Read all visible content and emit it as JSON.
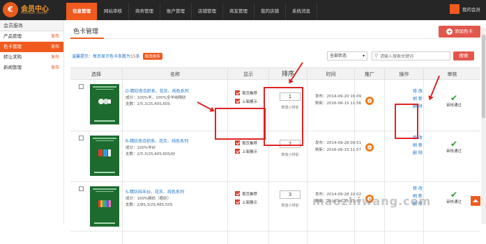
{
  "app": {
    "logo_glyph": "€",
    "title": "会员中心",
    "subtitle": "Member center"
  },
  "topnav": [
    {
      "label": "信息管理",
      "active": true
    },
    {
      "label": "网站审核"
    },
    {
      "label": "商务管理"
    },
    {
      "label": "账户管理"
    },
    {
      "label": "店铺管理"
    },
    {
      "label": "商友管理"
    },
    {
      "label": "我的店铺"
    },
    {
      "label": "系统消息"
    }
  ],
  "user": {
    "name": "我的会员"
  },
  "sidebar": {
    "heading": "会员服务",
    "items": [
      {
        "label": "产品管理",
        "tag": "发布"
      },
      {
        "label": "色卡管理",
        "tag": "发布",
        "active": true
      },
      {
        "label": "转让求购",
        "tag": "发布"
      },
      {
        "label": "新闻管理",
        "tag": "发布"
      }
    ]
  },
  "page": {
    "title": "色卡管理",
    "add_label": "添加色卡",
    "tip_label": "温馨提示：",
    "tip_text": "每页显示色卡条数为",
    "tip_red": "15",
    "tip_link": "条",
    "tip_button": "修改排序",
    "status_select": "全部状态",
    "search_placeholder": "请输入搜索关键词",
    "search_label": "搜索"
  },
  "columns": [
    "选择",
    "名称",
    "显示",
    "排序",
    "时间",
    "推广",
    "操作",
    "审核"
  ],
  "rows": [
    {
      "title": "D-精纺南合织系、花灰、纯色系列",
      "spec1": "成分：100%羊，100%全羊纯精纺",
      "spec2": "支数：2/5,3/2S,40S,60S",
      "show_home": "首页推荐",
      "show_list": "上架展示",
      "sort": "1",
      "sort_hint": "数值小排前",
      "published": "发布：2014-09-20 16:09",
      "updated": "刷新：2016-06-15 11:56",
      "op_edit": "修 改",
      "op_refresh": "刷 新",
      "op_delete": "删 除",
      "audit": "审核通过"
    },
    {
      "title": "R-精纺南合织系、花灰、纯色系列",
      "spec1": "成分：100%羊纱",
      "spec2": "支数：2/5,3/2S,40S,60S/纱",
      "show_home": "首页推荐",
      "show_list": "上架展示",
      "sort": "2",
      "sort_hint": "数值小排前",
      "published": "发布：2014-09-28 09:51",
      "updated": "刷新：2016-06-15 11:57",
      "op_edit": "修 改",
      "op_refresh": "刷 新",
      "op_delete": "删 除",
      "audit": "审核通过"
    },
    {
      "title": "S-精纺纯羊纱、花灰、纯色系列",
      "spec1": "成分：100%精纺（粗纺）",
      "spec2": "支数：2/8S,3/2S,48S,50S",
      "show_home": "首页推荐",
      "show_list": "上架展示",
      "sort": "3",
      "sort_hint": "数值小排前",
      "published": "发布：2014-09-28 10:02",
      "updated": "刷新：2016-06-15 11:57",
      "op_edit": "修 改",
      "op_refresh": "刷 新",
      "op_delete": "删 除",
      "audit": "审核通过"
    }
  ],
  "watermark": "maozhiwang.com"
}
